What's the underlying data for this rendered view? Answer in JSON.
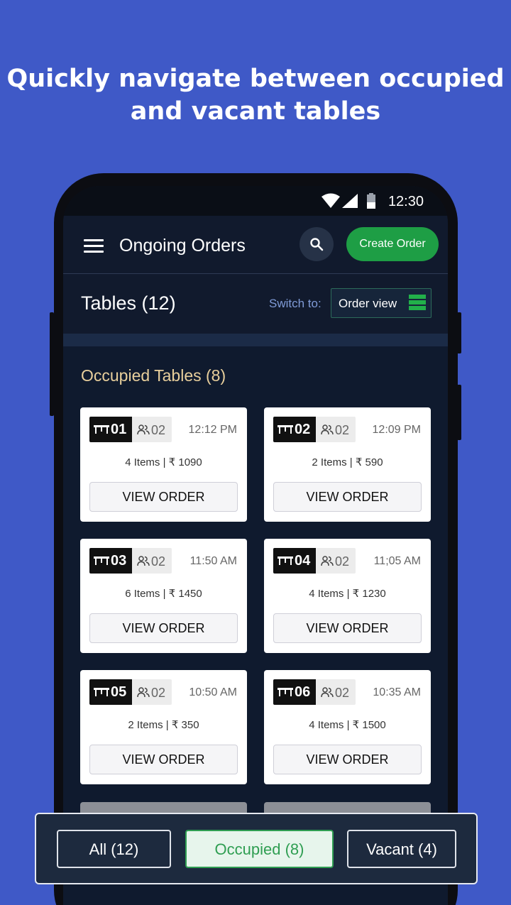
{
  "promo": {
    "line1": "Quickly navigate between occupied",
    "line2": "and vacant tables"
  },
  "status_bar": {
    "time": "12:30"
  },
  "app_bar": {
    "title": "Ongoing Orders",
    "create_label": "Create Order"
  },
  "tables_header": {
    "title": "Tables (12)",
    "switch_label": "Switch to:",
    "view_label": "Order view"
  },
  "section": {
    "title": "Occupied Tables (8)"
  },
  "cards": [
    {
      "table": "01",
      "guests": "02",
      "time": "12:12 PM",
      "summary": "4 Items | ₹ 1090",
      "action": "VIEW ORDER"
    },
    {
      "table": "02",
      "guests": "02",
      "time": "12:09 PM",
      "summary": "2 Items | ₹ 590",
      "action": "VIEW ORDER"
    },
    {
      "table": "03",
      "guests": "02",
      "time": "11:50 AM",
      "summary": "6 Items | ₹ 1450",
      "action": "VIEW ORDER"
    },
    {
      "table": "04",
      "guests": "02",
      "time": "11;05 AM",
      "summary": "4 Items | ₹ 1230",
      "action": "VIEW ORDER"
    },
    {
      "table": "05",
      "guests": "02",
      "time": "10:50 AM",
      "summary": "2 Items | ₹ 350",
      "action": "VIEW ORDER"
    },
    {
      "table": "06",
      "guests": "02",
      "time": "10:35 AM",
      "summary": "4 Items | ₹ 1500",
      "action": "VIEW ORDER"
    }
  ],
  "filters": {
    "all": "All (12)",
    "occupied": "Occupied (8)",
    "vacant": "Vacant (4)"
  },
  "colors": {
    "background": "#3f59c7",
    "accent_green": "#1e9e45",
    "section_title": "#e8cf9c"
  }
}
